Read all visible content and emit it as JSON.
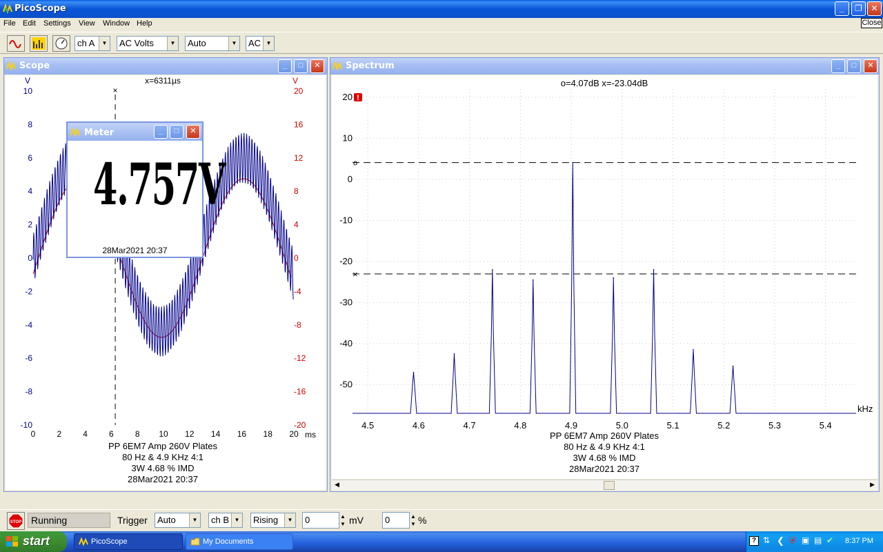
{
  "app": {
    "title": "PicoScope",
    "close_tooltip": "Close"
  },
  "menu": [
    "File",
    "Edit",
    "Settings",
    "View",
    "Window",
    "Help"
  ],
  "toolbar": {
    "channel": "ch A",
    "mode": "AC Volts",
    "range": "Auto",
    "coupling": "AC"
  },
  "scope": {
    "title": "Scope",
    "cursor_readout": "x=6311µs",
    "left_axis_unit": "V",
    "right_axis_unit": "V",
    "x_unit": "ms",
    "left_ticks": [
      "10",
      "8",
      "6",
      "4",
      "2",
      "0",
      "-2",
      "-4",
      "-6",
      "-8",
      "-10"
    ],
    "right_ticks": [
      "20",
      "16",
      "12",
      "8",
      "4",
      "0",
      "-4",
      "-8",
      "-12",
      "-16",
      "-20"
    ],
    "x_ticks": [
      "0",
      "2",
      "4",
      "6",
      "8",
      "10",
      "12",
      "14",
      "16",
      "18",
      "20"
    ],
    "notes": [
      "PP 6EM7 Amp 260V Plates",
      "80 Hz & 4.9 KHz 4:1",
      "3W 4.68 % IMD",
      "28Mar2021  20:37"
    ]
  },
  "meter": {
    "title": "Meter",
    "value": "4.757V",
    "timestamp": "28Mar2021  20:37"
  },
  "spectrum": {
    "title": "Spectrum",
    "cursor_readout": "o=4.07dB  x=-23.04dB",
    "y_ticks": [
      "20",
      "10",
      "0",
      "-10",
      "-20",
      "-30",
      "-40",
      "-50"
    ],
    "x_ticks": [
      "4.5",
      "4.6",
      "4.7",
      "4.8",
      "4.9",
      "5.0",
      "5.1",
      "5.2",
      "5.3",
      "5.4"
    ],
    "x_unit": "kHz",
    "marker_o": "o",
    "marker_x": "×",
    "notes": [
      "PP 6EM7 Amp 260V Plates",
      "80 Hz & 4.9 KHz 4:1",
      "3W 4.68 % IMD",
      "28Mar2021  20:37"
    ]
  },
  "status": {
    "state": "Running",
    "trigger_label": "Trigger",
    "trigger_mode": "Auto",
    "trigger_channel": "ch B",
    "trigger_edge": "Rising",
    "level": "0",
    "level_unit": "mV",
    "delay": "0",
    "delay_unit": "%"
  },
  "taskbar": {
    "start": "start",
    "tasks": [
      "PicoScope",
      "My Documents"
    ],
    "clock": "8:37 PM"
  },
  "chart_data": [
    {
      "type": "line",
      "title": "",
      "xlabel": "ms",
      "ylabel": "V",
      "xlim": [
        0,
        20
      ],
      "ylim": [
        -10,
        10
      ],
      "y2lim": [
        -20,
        20
      ],
      "grid": false,
      "series": [
        {
          "color": "#00008b",
          "description": "80 Hz sine with 4.9 kHz ripple",
          "x": [
            0,
            2,
            4,
            6,
            8,
            9,
            10,
            12,
            14,
            15.5,
            16,
            18,
            19,
            20
          ],
          "y": [
            1.5,
            7.5,
            5.5,
            0,
            -5.5,
            -7.5,
            -6.5,
            -2,
            5,
            8,
            7.5,
            3,
            -1,
            -5
          ]
        },
        {
          "color": "#cc0000",
          "axis": "right",
          "x": [
            0,
            2,
            4,
            6,
            8,
            9,
            10,
            12,
            14,
            15.5,
            16,
            18,
            19,
            20
          ],
          "y": [
            0,
            7,
            10,
            5,
            -4,
            -8,
            -8,
            -2,
            6,
            9.5,
            9.5,
            4,
            -1,
            -4
          ]
        }
      ]
    },
    {
      "type": "line",
      "title": "",
      "xlabel": "kHz",
      "ylabel": "",
      "xlim": [
        4.47,
        5.46
      ],
      "ylim": [
        -57,
        22
      ],
      "peaks": [
        {
          "x": 4.59,
          "y": -47
        },
        {
          "x": 4.67,
          "y": -42.5
        },
        {
          "x": 4.745,
          "y": -22
        },
        {
          "x": 4.825,
          "y": -24.5
        },
        {
          "x": 4.903,
          "y": 4.07
        },
        {
          "x": 4.983,
          "y": -24
        },
        {
          "x": 5.062,
          "y": -22
        },
        {
          "x": 5.14,
          "y": -41.5
        },
        {
          "x": 5.218,
          "y": -45.5
        }
      ],
      "baseline": -57,
      "cursor_o": 4.07,
      "cursor_x": -23.04
    }
  ]
}
